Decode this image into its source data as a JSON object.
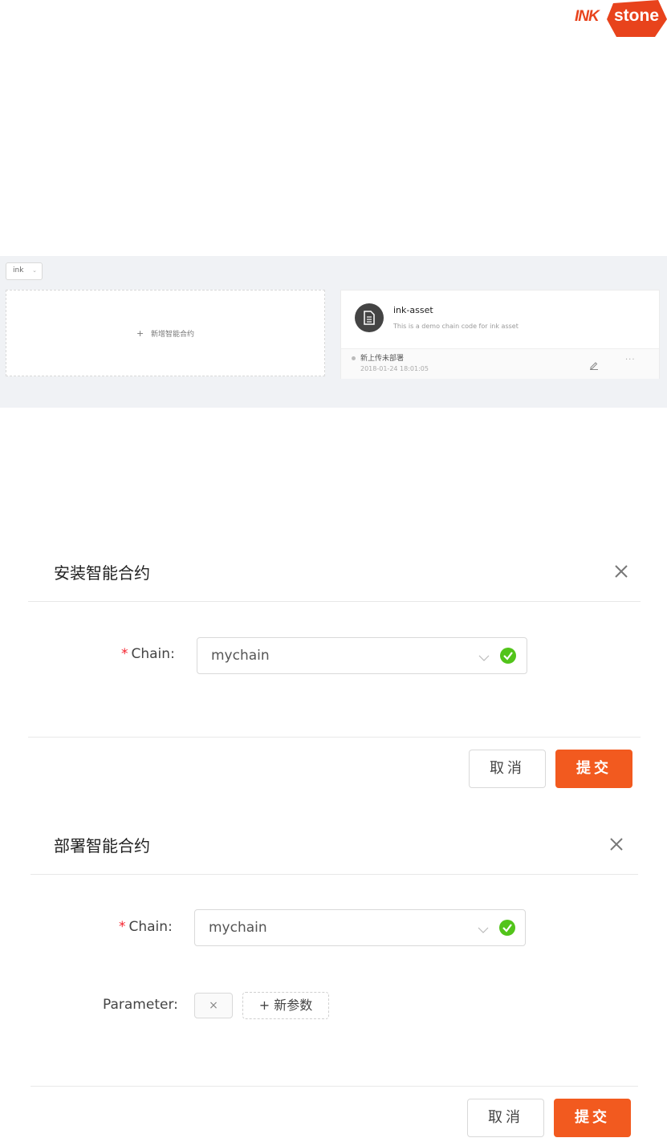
{
  "logo": {
    "ink": "INK",
    "stone": "stone",
    "brand_color": "#e8431c"
  },
  "panel": {
    "channel_select": "ink",
    "add_card_label": "新增智能合约",
    "chaincode": {
      "name": "ink-asset",
      "description": "This is a demo chain code for ink asset",
      "status": "新上传未部署",
      "time": "2018-01-24 18:01:05",
      "more": "···"
    }
  },
  "install_modal": {
    "title": "安装智能合约",
    "chain_label": "Chain",
    "chain_value": "mychain",
    "cancel_label": "取消",
    "submit_label": "提交"
  },
  "deploy_modal": {
    "title": "部署智能合约",
    "chain_label": "Chain",
    "chain_value": "mychain",
    "parameter_label": "Parameter",
    "remove_param": "×",
    "add_param_label": "+ 新参数",
    "cancel_label": "取消",
    "submit_label": "提交"
  },
  "colors": {
    "accent": "#f25a1f",
    "success": "#52c41a",
    "required": "#f5222d"
  }
}
